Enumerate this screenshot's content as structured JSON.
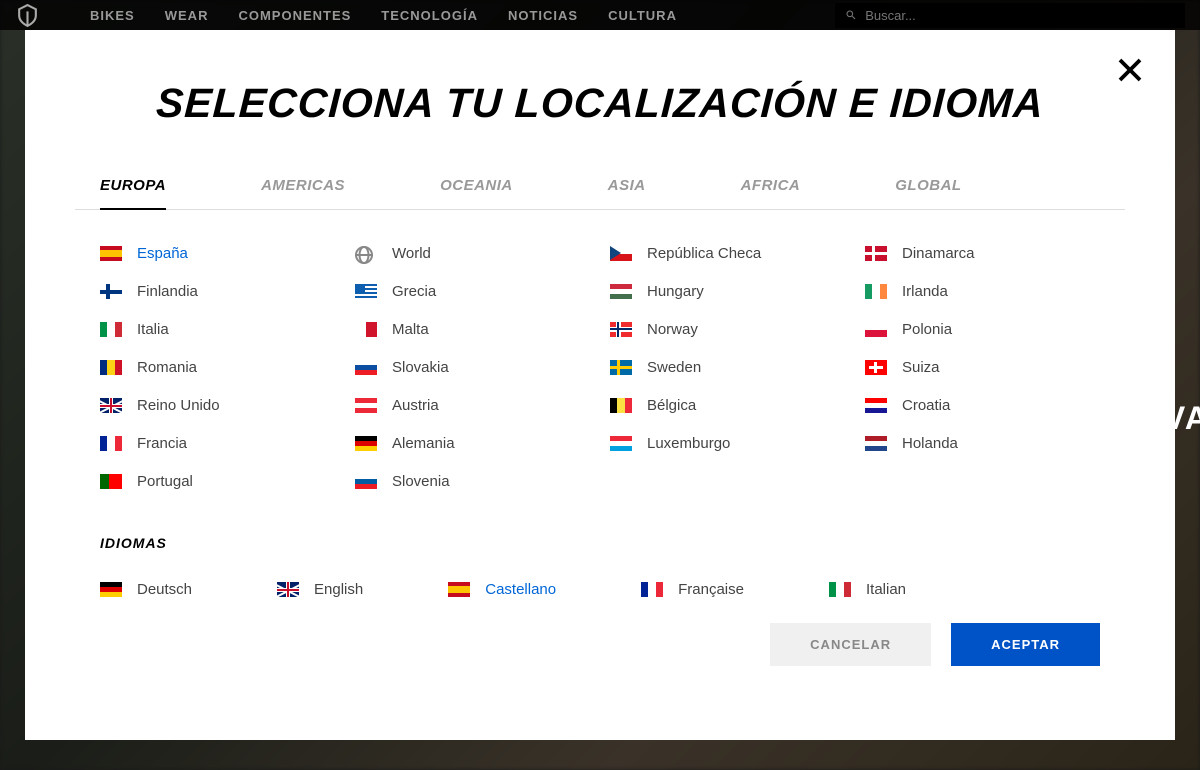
{
  "nav": [
    "BIKES",
    "WEAR",
    "COMPONENTES",
    "TECNOLOGÍA",
    "NOTICIAS",
    "CULTURA"
  ],
  "search_ph": "Buscar...",
  "modal_title": "SELECCIONA TU LOCALIZACIÓN E IDIOMA",
  "tabs": [
    "EUROPA",
    "AMERICAS",
    "OCEANIA",
    "ASIA",
    "AFRICA",
    "GLOBAL"
  ],
  "countries": [
    {
      "n": "España",
      "f": "es",
      "sel": true
    },
    {
      "n": "World",
      "f": "globe"
    },
    {
      "n": "República Checa",
      "f": "cz"
    },
    {
      "n": "Dinamarca",
      "f": "dk"
    },
    {
      "n": "Finlandia",
      "f": "fi"
    },
    {
      "n": "Grecia",
      "f": "gr"
    },
    {
      "n": "Hungary",
      "f": "hu"
    },
    {
      "n": "Irlanda",
      "f": "ie"
    },
    {
      "n": "Italia",
      "f": "it"
    },
    {
      "n": "Malta",
      "f": "mt"
    },
    {
      "n": "Norway",
      "f": "no"
    },
    {
      "n": "Polonia",
      "f": "pl"
    },
    {
      "n": "Romania",
      "f": "ro"
    },
    {
      "n": "Slovakia",
      "f": "sk"
    },
    {
      "n": "Sweden",
      "f": "se"
    },
    {
      "n": "Suiza",
      "f": "ch"
    },
    {
      "n": "Reino Unido",
      "f": "gb"
    },
    {
      "n": "Austria",
      "f": "at"
    },
    {
      "n": "Bélgica",
      "f": "be"
    },
    {
      "n": "Croatia",
      "f": "hr"
    },
    {
      "n": "Francia",
      "f": "fr"
    },
    {
      "n": "Alemania",
      "f": "de"
    },
    {
      "n": "Luxemburgo",
      "f": "lu"
    },
    {
      "n": "Holanda",
      "f": "nl"
    },
    {
      "n": "Portugal",
      "f": "pt"
    },
    {
      "n": "Slovenia",
      "f": "si"
    }
  ],
  "langs_title": "IDIOMAS",
  "langs": [
    {
      "n": "Deutsch",
      "f": "de"
    },
    {
      "n": "English",
      "f": "gb"
    },
    {
      "n": "Castellano",
      "f": "es",
      "sel": true
    },
    {
      "n": "Française",
      "f": "fr"
    },
    {
      "n": "Italian",
      "f": "it"
    }
  ],
  "cancel": "CANCELAR",
  "accept": "ACEPTAR",
  "bgtext": "TH\nEVA"
}
